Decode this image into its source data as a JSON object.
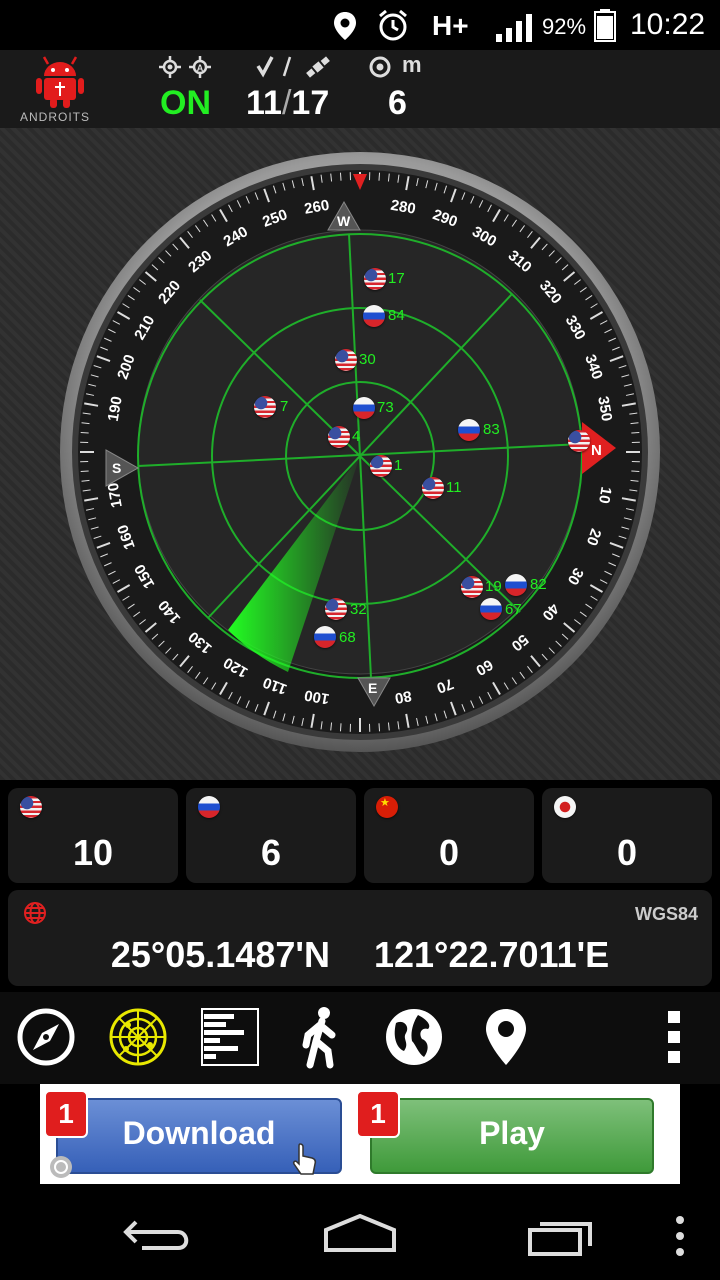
{
  "status_bar": {
    "network": "H+",
    "battery": "92%",
    "time": "10:22"
  },
  "app": {
    "logo_text": "ANDROITS",
    "gps_state": "ON",
    "satellites_used": "11",
    "satellites_separator": "/",
    "satellites_visible": "17",
    "accuracy": "6",
    "accuracy_unit": "m"
  },
  "compass": {
    "cardinals": {
      "north": "N",
      "south": "S",
      "east": "E",
      "west": "W"
    },
    "degree_labels": [
      "280",
      "290",
      "300",
      "310",
      "320",
      "330",
      "340",
      "350",
      "10",
      "20",
      "30",
      "40",
      "50",
      "60",
      "70",
      "80",
      "100",
      "110",
      "120",
      "130",
      "140",
      "150",
      "160",
      "170",
      "190",
      "200",
      "210",
      "220",
      "230",
      "240",
      "250",
      "260"
    ]
  },
  "satellites": [
    {
      "id": "17",
      "flag": "usa"
    },
    {
      "id": "84",
      "flag": "rus"
    },
    {
      "id": "30",
      "flag": "usa"
    },
    {
      "id": "7",
      "flag": "usa"
    },
    {
      "id": "73",
      "flag": "rus"
    },
    {
      "id": "4",
      "flag": "usa"
    },
    {
      "id": "83",
      "flag": "rus"
    },
    {
      "id": "1",
      "flag": "usa"
    },
    {
      "id": "11",
      "flag": "usa"
    },
    {
      "id": "19",
      "flag": "usa"
    },
    {
      "id": "82",
      "flag": "rus"
    },
    {
      "id": "67",
      "flag": "rus"
    },
    {
      "id": "32",
      "flag": "usa"
    },
    {
      "id": "68",
      "flag": "rus"
    },
    {
      "id": "",
      "flag": "usa"
    }
  ],
  "constellations": [
    {
      "flag": "usa",
      "count": "10"
    },
    {
      "flag": "rus",
      "count": "6"
    },
    {
      "flag": "chn",
      "count": "0"
    },
    {
      "flag": "jpn",
      "count": "0"
    }
  ],
  "location": {
    "datum": "WGS84",
    "latitude": "25°05.1487'N",
    "longitude": "121°22.7011'E"
  },
  "toolbar": [
    "compass-icon",
    "radar-icon",
    "signal-bars-icon",
    "walking-icon",
    "globe-icon",
    "map-pin-icon",
    "overflow-menu-icon"
  ],
  "ad": {
    "download_label": "Download",
    "play_label": "Play",
    "download_badge": "1",
    "play_badge": "1"
  },
  "colors": {
    "accent_green": "#22ee22",
    "radar_line": "#1fae2a",
    "north_red": "#e02020"
  }
}
